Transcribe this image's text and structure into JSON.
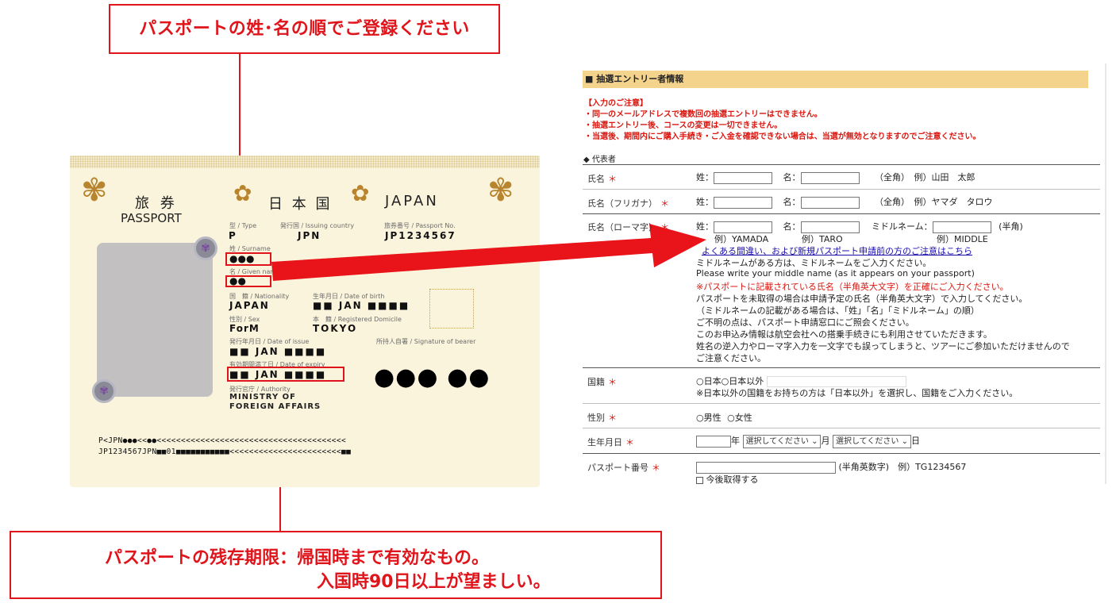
{
  "callouts": {
    "top": "パスポートの姓･名の順でご登録ください",
    "bottom_line1": "パスポートの残存期限：帰国時まで有効なもの。",
    "bottom_line2": "入国時90日以上が望ましい。"
  },
  "passport": {
    "title_jp": "旅  券",
    "title_en": "PASSPORT",
    "country_jp": "日 本 国",
    "country_en": "JAPAN",
    "crest_icon": "chrysanthemum-crest",
    "type_label": "型 / Type",
    "type_value": "P",
    "issuing_label": "発行国 / Issuing country",
    "issuing_value": "JPN",
    "number_label": "旅券番号 / Passport No.",
    "number_value": "JP1234567",
    "surname_label": "姓 / Surname",
    "surname_value": "●●●",
    "given_label": "名 / Given name",
    "given_value": "●●",
    "nationality_label": "国　籍 / Nationality",
    "nationality_value": "JAPAN",
    "dob_label": "生年月日 / Date of birth",
    "dob_value": "■■  JAN  ■■■■",
    "sex_label": "性別 / Sex",
    "sex_value": "ForM",
    "domicile_label": "本　籍 / Registered Domicile",
    "domicile_value": "TOKYO",
    "issue_label": "発行年月日 / Date of issue",
    "issue_value": "■■  JAN  ■■■■",
    "signature_label": "所持人自署 / Signature of bearer",
    "expiry_label": "有効期間満了日 / Date of expiry",
    "expiry_value": "■■  JAN  ■■■■",
    "authority_label": "発行官庁 / Authority",
    "authority_line1": "MINISTRY OF",
    "authority_line2": "FOREIGN AFFAIRS",
    "signature_mark": "●●● ●●",
    "mrz1": "P<JPN●●●<<●●<<<<<<<<<<<<<<<<<<<<<<<<<<<<<<<<<<<<<<<",
    "mrz2": "JP1234567JPN■■01■■■■■■■■■■■<<<<<<<<<<<<<<<<<<<<<<<■■"
  },
  "form": {
    "section_title": "■ 抽選エントリー者情報",
    "notices": [
      "【入力のご注意】",
      "・同一のメールアドレスで複数回の抽選エントリーはできません。",
      "・抽選エントリー後、コースの変更は一切できません。",
      "・当選後、期間内にご購入手続き・ご入金を確認できない場合は、当選が無効となりますのでご注意ください。"
    ],
    "representative": "◆ 代表者",
    "required_mark": "＊",
    "name": {
      "label": "氏名",
      "sei": "姓：",
      "mei": "名：",
      "note": "（全角）　例）山田　太郎"
    },
    "furigana": {
      "label": "氏名（フリガナ）",
      "sei": "姓：",
      "mei": "名：",
      "note": "（全角）　例）ヤマダ　タロウ"
    },
    "romaji": {
      "label": "氏名（ローマ字）",
      "sei": "姓：",
      "mei": "名：",
      "middle": "ミドルネーム：",
      "halfwidth": "(半角)",
      "ex_sei": "例）YAMADA",
      "ex_mei": "例）TARO",
      "ex_middle": "例）MIDDLE",
      "link": "よくある間違い、および新規パスポート申請前の方のご注意はこちら",
      "lines": [
        "ミドルネームがある方は、ミドルネームをご入力ください。",
        "Please write your middle name (as it appears on your passport)",
        "※パスポートに記載されている氏名（半角英大文字）を正確にご入力ください。",
        "パスポートを未取得の場合は申請予定の氏名（半角英大文字）で入力してください。",
        "（ミドルネームの記載がある場合は、「姓」「名」「ミドルネーム」の順）",
        "ご不明の点は、パスポート申請窓口にご照会ください。",
        "このお申込み情報は航空会社への搭乗手続きにも利用させていただきます。",
        "姓名の逆入力やローマ字入力を一文字でも誤ってしまうと、ツアーにご参加いただけませんので",
        "ご注意ください。"
      ]
    },
    "nationality": {
      "label": "国籍",
      "opt1": "○日本",
      "opt2": "○日本以外",
      "note": "※日本以外の国籍をお持ちの方は「日本以外」を選択し、国籍をご入力ください。"
    },
    "sex": {
      "label": "性別",
      "opt1": "○男性",
      "opt2": "○女性"
    },
    "dob": {
      "label": "生年月日",
      "year": "年",
      "month_select": "選択してください",
      "month": "月",
      "day_select": "選択してください",
      "day": "日"
    },
    "passport_no": {
      "label": "パスポート番号",
      "note": "(半角英数字)　例）TG1234567",
      "checkbox": "今後取得する"
    }
  },
  "colors": {
    "accent_red": "#e0141b",
    "section_header": "#f4d38d",
    "passport_bg": "#fbf4dd",
    "link_blue": "#1a0dab"
  }
}
